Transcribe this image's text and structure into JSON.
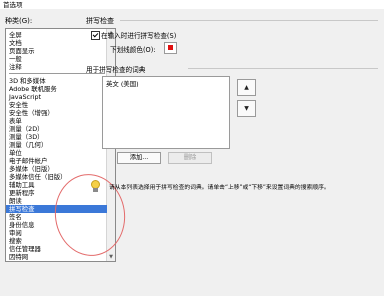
{
  "window": {
    "title": "首选项"
  },
  "categories": {
    "label": "种类(G):",
    "group1": [
      "全屏",
      "文档",
      "页面显示",
      "一般",
      "注释"
    ],
    "group2": [
      "3D 和多媒体",
      "Adobe 联机服务",
      "JavaScript",
      "安全性",
      "安全性（增强）",
      "表单",
      "测量（2D）",
      "测量（3D）",
      "测量（几何）",
      "单位",
      "电子邮件帐户",
      "多媒体（旧版）",
      "多媒体信任（旧版）",
      "辅助工具",
      "更新程序",
      "朗读",
      "拼写检查",
      "签名",
      "身份信息",
      "审阅",
      "搜索",
      "信任管理器",
      "因特网",
      "追踪器"
    ],
    "selected": "拼写检查"
  },
  "spell": {
    "section_title": "拼写检查",
    "check_while_typing": "在输入时进行拼写检查(S)",
    "check_while_typing_checked": true,
    "underline_label": "下划线颜色(O):",
    "underline_color": "#e01010"
  },
  "dictionaries": {
    "section_title": "用于拼写检查的词典",
    "items": [
      "英文 (美国)"
    ],
    "add_label": "添加...",
    "delete_label": "删除",
    "move_up_icon": "triangle-up-icon",
    "move_down_icon": "triangle-down-icon"
  },
  "hint": {
    "icon": "lightbulb-icon",
    "text": "请从本列表选择用于拼写检查的词典。请单击“上移”或“下移”来设置词典的搜索顺序。"
  },
  "annotation": {
    "color": "#e36b6b"
  }
}
